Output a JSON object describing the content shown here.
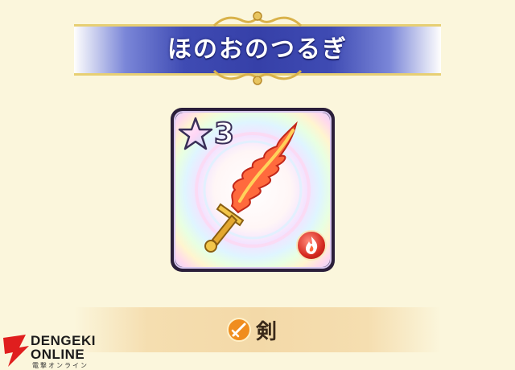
{
  "item": {
    "name": "ほのおのつるぎ",
    "rarity_stars": "3",
    "element_icon": "fire-icon",
    "type_icon": "sword-icon",
    "type_label": "剣"
  },
  "watermark": {
    "line1": "DENGEKI",
    "line2": "ONLINE",
    "line3": "電撃オンライン"
  },
  "colors": {
    "banner": "#3640a8",
    "banner_trim": "#e7cf73",
    "background": "#fbf6dc",
    "element_fire": "#d62a20",
    "sword_blade": "#ff5a3a"
  }
}
